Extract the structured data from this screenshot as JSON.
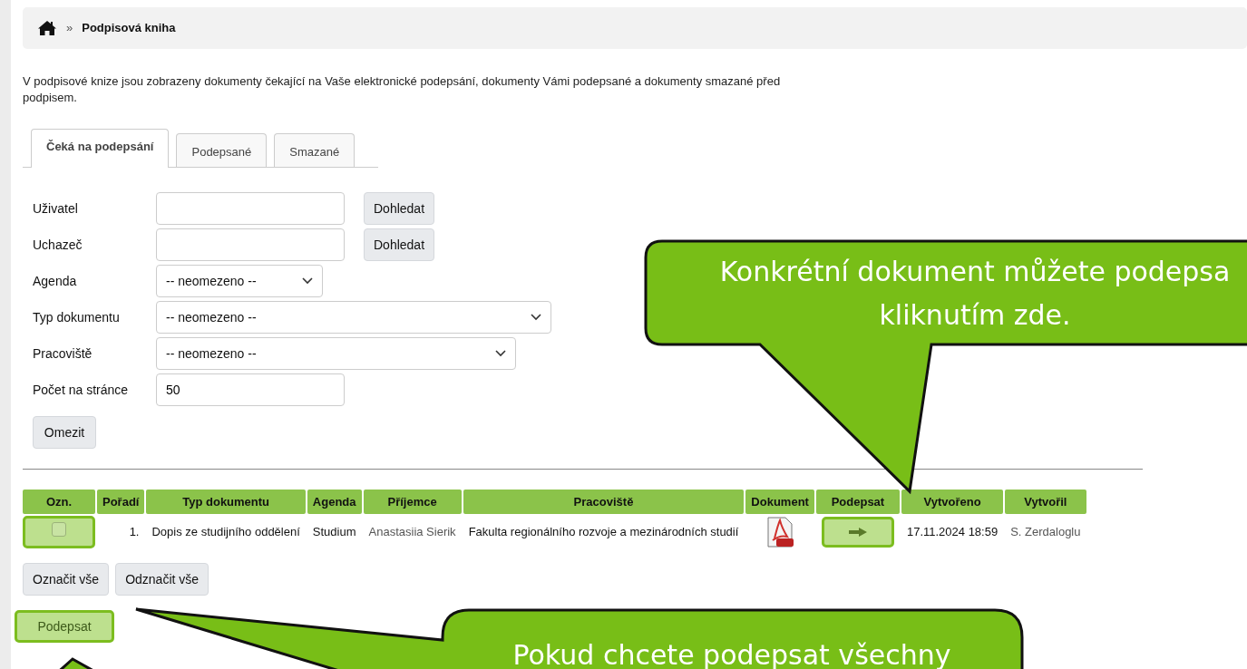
{
  "breadcrumb": {
    "separator": "»",
    "current": "Podpisová kniha"
  },
  "intro": "V podpisové knize jsou zobrazeny dokumenty čekající na Vaše elektronické podepsání, dokumenty Vámi podepsané a dokumenty smazané před podpisem.",
  "tabs": [
    {
      "label": "Čeká na podepsání",
      "selected": true
    },
    {
      "label": "Podepsané",
      "selected": false
    },
    {
      "label": "Smazané",
      "selected": false
    }
  ],
  "filters": [
    {
      "kind": "text",
      "label": "Uživatel",
      "button": "Dohledat"
    },
    {
      "kind": "text",
      "label": "Uchazeč",
      "button": "Dohledat"
    },
    {
      "kind": "select",
      "label": "Agenda",
      "value": "-- neomezeno --"
    },
    {
      "kind": "select",
      "label": "Typ dokumentu",
      "value": "-- neomezeno --"
    },
    {
      "kind": "select",
      "label": "Pracoviště",
      "value": "-- neomezeno --"
    },
    {
      "kind": "text",
      "label": "Počet na stránce",
      "value": "50"
    }
  ],
  "filter_button": "Omezit",
  "table": {
    "columns": [
      "Ozn.",
      "Pořadí",
      "Typ dokumentu",
      "Agenda",
      "Příjemce",
      "Pracoviště",
      "Dokument",
      "Podepsat",
      "Vytvořeno",
      "Vytvořil"
    ],
    "rows": [
      {
        "checked": false,
        "highlighted": true,
        "order": "1.",
        "type": "Dopis ze studijního oddělení",
        "agenda": "Studium",
        "recipient": "Anastasiia Sierik",
        "workplace": "Fakulta regionálního rozvoje a mezinárodních studií",
        "sign_highlighted": true,
        "created": "17.11.2024 18:59",
        "author": "S. Zerdaloglu"
      }
    ]
  },
  "buttons": [
    "Označit vše",
    "Odznačit vše"
  ],
  "sign_button": {
    "label": "Podepsat",
    "highlighted": true
  },
  "callouts": [
    {
      "lines": [
        "Konkrétní dokument můžete podepsa",
        "kliknutím zde."
      ]
    },
    {
      "lines": [
        "Pokud chcete podepsat všechny"
      ]
    }
  ]
}
